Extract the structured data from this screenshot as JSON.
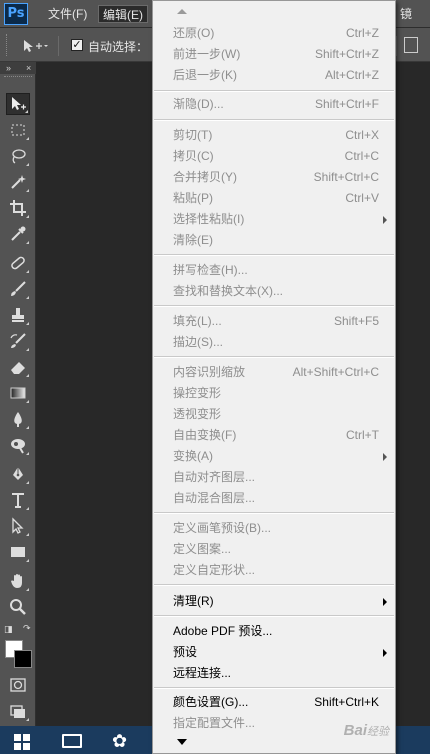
{
  "app": {
    "logo": "Ps"
  },
  "menubar": {
    "items": [
      {
        "label": "文件(F)"
      },
      {
        "label": "编辑(E)"
      },
      {
        "label": "镜"
      }
    ]
  },
  "options": {
    "auto_select_label": "自动选择："
  },
  "toolbar": {
    "collapse": "»",
    "close": "×"
  },
  "edit_menu": {
    "items": [
      {
        "label": "还原(O)",
        "shortcut": "Ctrl+Z"
      },
      {
        "label": "前进一步(W)",
        "shortcut": "Shift+Ctrl+Z"
      },
      {
        "label": "后退一步(K)",
        "shortcut": "Alt+Ctrl+Z"
      },
      {
        "label": "渐隐(D)...",
        "shortcut": "Shift+Ctrl+F"
      },
      {
        "label": "剪切(T)",
        "shortcut": "Ctrl+X"
      },
      {
        "label": "拷贝(C)",
        "shortcut": "Ctrl+C"
      },
      {
        "label": "合并拷贝(Y)",
        "shortcut": "Shift+Ctrl+C"
      },
      {
        "label": "粘贴(P)",
        "shortcut": "Ctrl+V"
      },
      {
        "label": "选择性粘贴(I)",
        "shortcut": ""
      },
      {
        "label": "清除(E)",
        "shortcut": ""
      },
      {
        "label": "拼写检查(H)...",
        "shortcut": ""
      },
      {
        "label": "查找和替换文本(X)...",
        "shortcut": ""
      },
      {
        "label": "填充(L)...",
        "shortcut": "Shift+F5"
      },
      {
        "label": "描边(S)...",
        "shortcut": ""
      },
      {
        "label": "内容识别缩放",
        "shortcut": "Alt+Shift+Ctrl+C"
      },
      {
        "label": "操控变形",
        "shortcut": ""
      },
      {
        "label": "透视变形",
        "shortcut": ""
      },
      {
        "label": "自由变换(F)",
        "shortcut": "Ctrl+T"
      },
      {
        "label": "变换(A)",
        "shortcut": ""
      },
      {
        "label": "自动对齐图层...",
        "shortcut": ""
      },
      {
        "label": "自动混合图层...",
        "shortcut": ""
      },
      {
        "label": "定义画笔预设(B)...",
        "shortcut": ""
      },
      {
        "label": "定义图案...",
        "shortcut": ""
      },
      {
        "label": "定义自定形状...",
        "shortcut": ""
      },
      {
        "label": "清理(R)",
        "shortcut": ""
      },
      {
        "label": "Adobe PDF 预设...",
        "shortcut": ""
      },
      {
        "label": "预设",
        "shortcut": ""
      },
      {
        "label": "远程连接...",
        "shortcut": ""
      },
      {
        "label": "颜色设置(G)...",
        "shortcut": "Shift+Ctrl+K"
      },
      {
        "label": "指定配置文件...",
        "shortcut": ""
      }
    ]
  },
  "watermark": {
    "text": "Bai",
    "sub": "经验"
  }
}
